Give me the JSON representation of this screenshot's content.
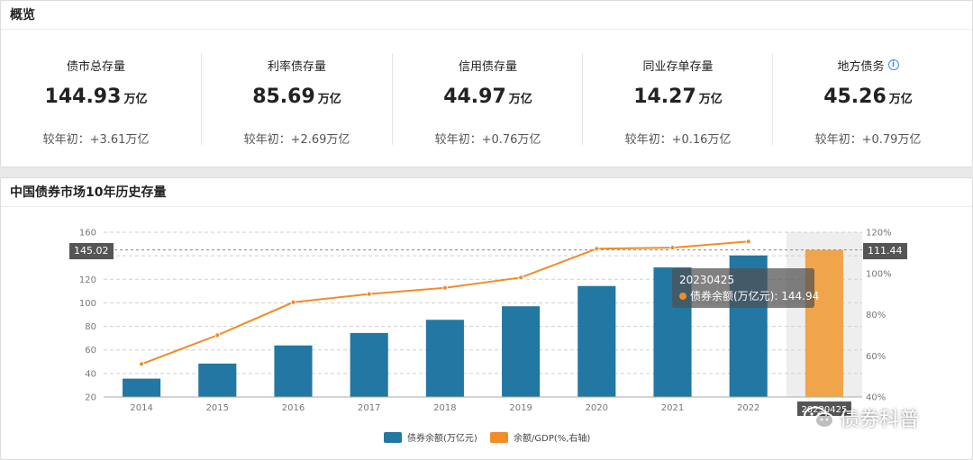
{
  "overview": {
    "title": "概览",
    "stats": [
      {
        "label": "债市总存量",
        "value": "144.93",
        "unit": "万亿",
        "change": "较年初：+3.61万亿"
      },
      {
        "label": "利率债存量",
        "value": "85.69",
        "unit": "万亿",
        "change": "较年初：+2.69万亿"
      },
      {
        "label": "信用债存量",
        "value": "44.97",
        "unit": "万亿",
        "change": "较年初：+0.76万亿"
      },
      {
        "label": "同业存单存量",
        "value": "14.27",
        "unit": "万亿",
        "change": "较年初：+0.16万亿"
      },
      {
        "label": "地方债务",
        "value": "45.26",
        "unit": "万亿",
        "change": "较年初：+0.79万亿",
        "info_icon": "info-icon"
      }
    ]
  },
  "history": {
    "title": "中国债券市场10年历史存量"
  },
  "tooltip": {
    "date": "20230425",
    "series": "债券余额(万亿元)",
    "value": "144.94"
  },
  "axis_tags": {
    "left": "145.02",
    "right": "111.44"
  },
  "watermark": {
    "text": "债券科普"
  },
  "colors": {
    "bar": "#2277a3",
    "bar_highlight": "#f0a54a",
    "line": "#f08c2a",
    "highlight_band": "#eeeeee"
  },
  "chart_data": {
    "type": "bar",
    "categories": [
      "2014",
      "2015",
      "2016",
      "2017",
      "2018",
      "2019",
      "2020",
      "2021",
      "2022",
      "20230425"
    ],
    "series": [
      {
        "name": "债券余额(万亿元)",
        "type": "bar",
        "axis": "left",
        "values": [
          35.6,
          48.4,
          63.8,
          74.4,
          85.6,
          97.1,
          114.3,
          130.1,
          140.3,
          144.94
        ]
      },
      {
        "name": "余额/GDP(%,右轴)",
        "type": "line",
        "axis": "right",
        "values": [
          56,
          70,
          86,
          90,
          93,
          98,
          112,
          112.5,
          115.5,
          null
        ]
      }
    ],
    "ylim": [
      20,
      160
    ],
    "yticks": [
      20,
      40,
      60,
      80,
      100,
      120,
      140,
      160
    ],
    "y2lim": [
      40,
      120
    ],
    "y2ticks": [
      "40%",
      "60%",
      "80%",
      "100%",
      "120%"
    ],
    "highlighted_category": "20230425",
    "grid": true,
    "legend_position": "bottom-center"
  }
}
